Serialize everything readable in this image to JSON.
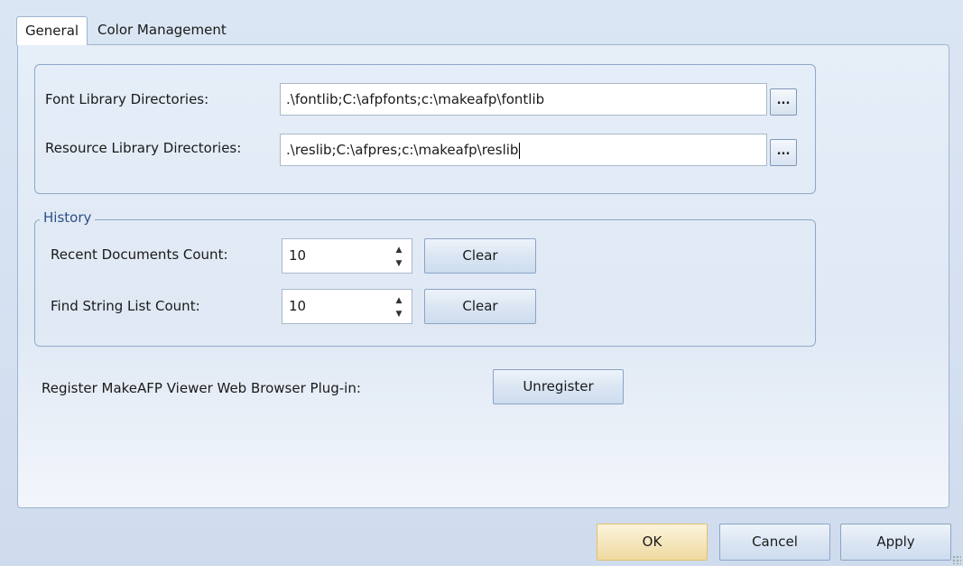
{
  "tabs": [
    {
      "label": "General",
      "active": true
    },
    {
      "label": "Color Management",
      "active": false
    }
  ],
  "directories": {
    "font_label": "Font Library Directories:",
    "font_value": ".\\fontlib;C:\\afpfonts;c:\\makeafp\\fontlib",
    "resource_label": "Resource Library Directories:",
    "resource_value": ".\\reslib;C:\\afpres;c:\\makeafp\\reslib",
    "browse_label": "..."
  },
  "history": {
    "legend": "History",
    "recent_label": "Recent Documents Count:",
    "recent_value": "10",
    "find_label": "Find String List Count:",
    "find_value": "10",
    "clear_label": "Clear",
    "spin_up": "▲",
    "spin_down": "▼"
  },
  "plugin": {
    "label": "Register MakeAFP Viewer Web Browser Plug-in:",
    "button": "Unregister"
  },
  "footer": {
    "ok": "OK",
    "cancel": "Cancel",
    "apply": "Apply"
  }
}
